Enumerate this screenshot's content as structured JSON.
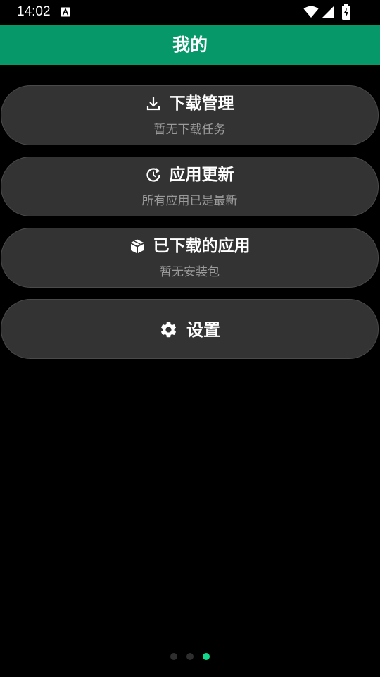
{
  "status_bar": {
    "time": "14:02",
    "icons": [
      "accessibility-a-icon",
      "wifi-icon",
      "signal-icon",
      "battery-charging-icon"
    ]
  },
  "app_bar": {
    "title": "我的",
    "color": "#079869"
  },
  "cards": [
    {
      "icon": "download-icon",
      "title": "下载管理",
      "subtitle": "暂无下载任务"
    },
    {
      "icon": "update-history-icon",
      "title": "应用更新",
      "subtitle": "所有应用已是最新"
    },
    {
      "icon": "package-icon",
      "title": "已下载的应用",
      "subtitle": "暂无安装包"
    },
    {
      "icon": "gear-icon",
      "title": "设置"
    }
  ],
  "page_indicator": {
    "count": 3,
    "active_index": 2,
    "active_color": "#10d98a"
  }
}
